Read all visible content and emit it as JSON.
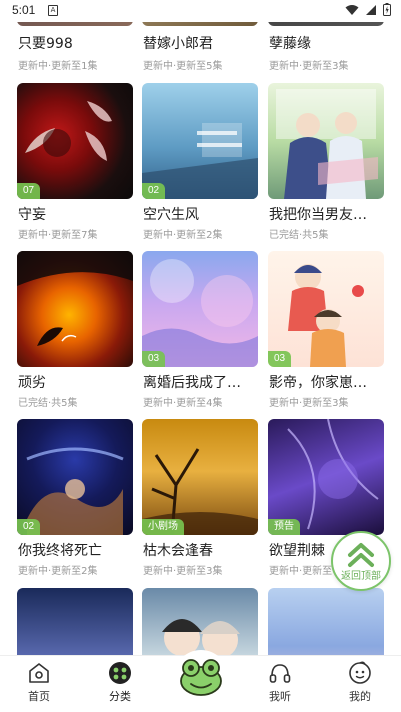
{
  "status_bar": {
    "time": "5:01",
    "notification_glyph": "A"
  },
  "feed": {
    "items": [
      {
        "title": "只要998",
        "meta": "更新中·更新至1集",
        "badge": ""
      },
      {
        "title": "替嫁小郎君",
        "meta": "更新中·更新至5集",
        "badge": ""
      },
      {
        "title": "孽藤缘",
        "meta": "更新中·更新至3集",
        "badge": ""
      },
      {
        "title": "守妄",
        "meta": "更新中·更新至7集",
        "badge": "07"
      },
      {
        "title": "空穴生风",
        "meta": "更新中·更新至2集",
        "badge": "02"
      },
      {
        "title": "我把你当男友…",
        "meta": "已完结·共5集",
        "badge": ""
      },
      {
        "title": "顽劣",
        "meta": "已完结·共5集",
        "badge": ""
      },
      {
        "title": "离婚后我成了…",
        "meta": "更新中·更新至4集",
        "badge": "03"
      },
      {
        "title": "影帝，你家崽…",
        "meta": "更新中·更新至3集",
        "badge": "03"
      },
      {
        "title": "你我终将死亡",
        "meta": "更新中·更新至2集",
        "badge": "02"
      },
      {
        "title": "枯木会逢春",
        "meta": "更新中·更新至3集",
        "badge": "小剧场"
      },
      {
        "title": "欲望荆棘",
        "meta": "更新中·更新至",
        "badge": "预告"
      }
    ]
  },
  "back_to_top": {
    "label": "返回顶部"
  },
  "tabbar": {
    "home": "首页",
    "category": "分类",
    "listen": "我听",
    "mine": "我的"
  },
  "colors": {
    "accent": "#7cc46a",
    "badge": "#78c350",
    "meta": "#9a9a9a"
  }
}
